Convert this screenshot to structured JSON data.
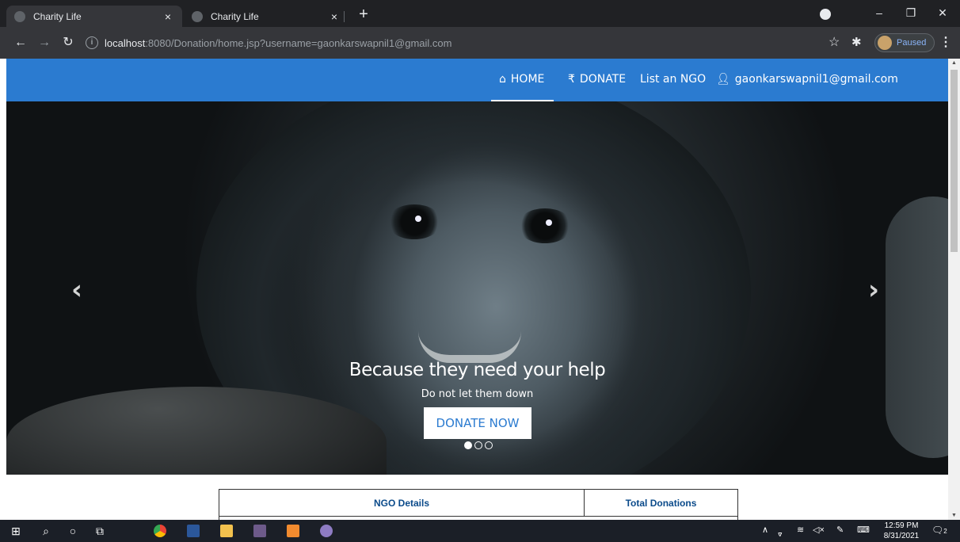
{
  "browser": {
    "tabs": [
      {
        "title": "Charity Life",
        "active": true,
        "close": "×"
      },
      {
        "title": "Charity Life",
        "active": false,
        "close": "×"
      }
    ],
    "new_tab": "+",
    "url_host": "localhost",
    "url_rest": ":8080/Donation/home.jsp?username=gaonkarswapnil1@gmail.com",
    "profile_status": "Paused"
  },
  "nav": {
    "home": "HOME",
    "donate": "DONATE",
    "list_ngo": "List an NGO",
    "user": "gaonkarswapnil1@gmail.com"
  },
  "hero": {
    "heading": "Because they need your help",
    "subheading": "Do not let them down",
    "button": "DONATE NOW",
    "slide_count": 3,
    "active_slide": 1
  },
  "table": {
    "headers": [
      "NGO Details",
      "Total Donations"
    ]
  },
  "taskbar": {
    "time": "12:59 PM",
    "date": "8/31/2021",
    "notification_count": "2"
  },
  "colors": {
    "brand": "#2b7bd0",
    "table_header_text": "#0a4a8a"
  }
}
